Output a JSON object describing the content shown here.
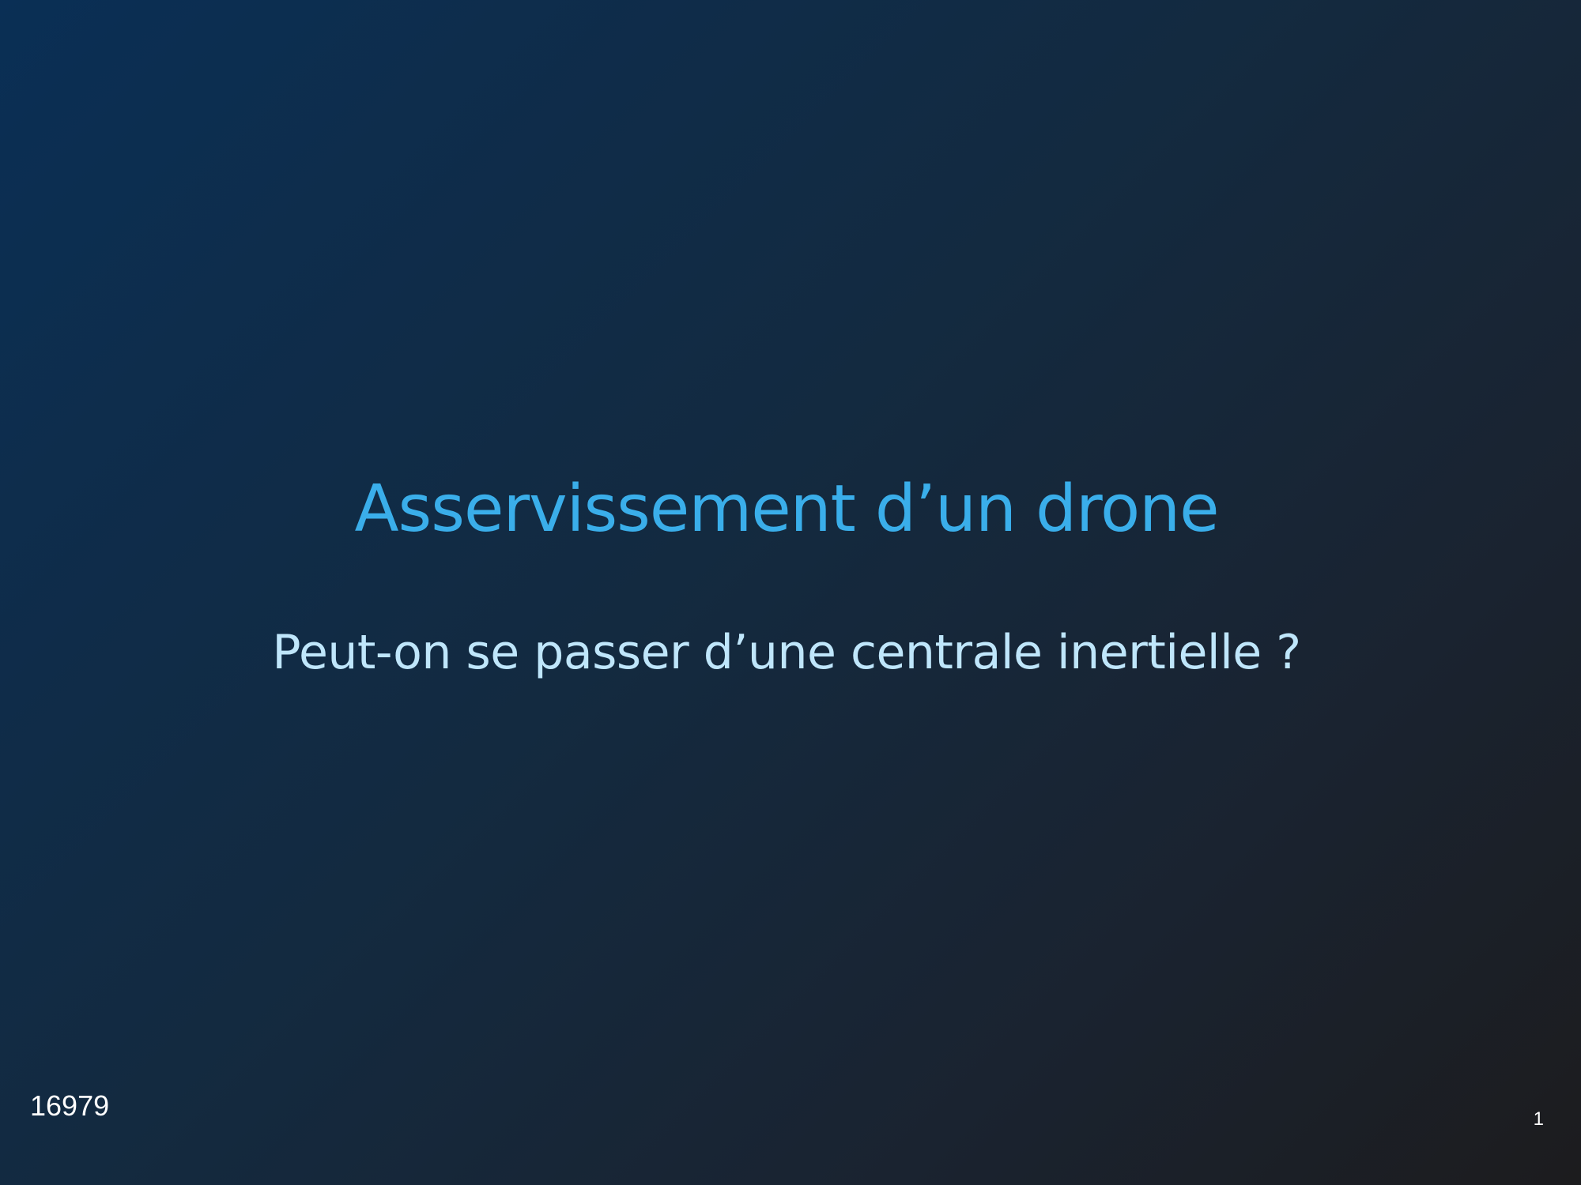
{
  "slide": {
    "title": "Asservissement d’un drone",
    "subtitle": "Peut-on se passer d’une centrale inertielle ?",
    "footer_id": "16979",
    "page_number": "1"
  },
  "colors": {
    "title": "#3aaeea",
    "subtitle": "#bfe6fb",
    "footer_text": "#ffffff",
    "background_start": "#0a2f55",
    "background_end": "#1c1c1e"
  }
}
